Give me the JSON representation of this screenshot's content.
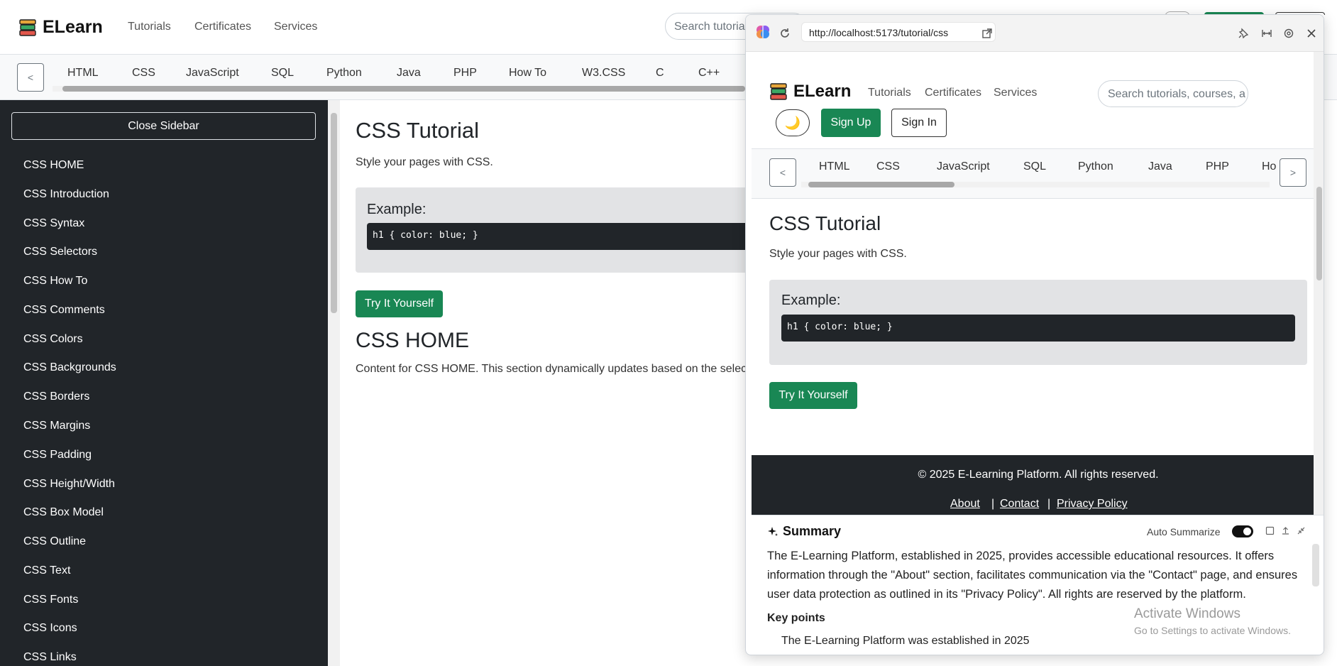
{
  "main": {
    "brand": "ELearn",
    "nav": [
      "Tutorials",
      "Certificates",
      "Services"
    ],
    "search_placeholder": "Search tutorials, courses, a",
    "subnav_prev": "<",
    "subnav": [
      "HTML",
      "CSS",
      "JavaScript",
      "SQL",
      "Python",
      "Java",
      "PHP",
      "How To",
      "W3.CSS",
      "C",
      "C++"
    ],
    "close_sidebar": "Close Sidebar",
    "sidebar": [
      "CSS HOME",
      "CSS Introduction",
      "CSS Syntax",
      "CSS Selectors",
      "CSS How To",
      "CSS Comments",
      "CSS Colors",
      "CSS Backgrounds",
      "CSS Borders",
      "CSS Margins",
      "CSS Padding",
      "CSS Height/Width",
      "CSS Box Model",
      "CSS Outline",
      "CSS Text",
      "CSS Fonts",
      "CSS Icons",
      "CSS Links"
    ],
    "title": "CSS Tutorial",
    "lead": "Style your pages with CSS.",
    "example_title": "Example:",
    "code": "h1 { color: blue; }",
    "try_button": "Try It Yourself",
    "section_title": "CSS HOME",
    "section_text": "Content for CSS HOME. This section dynamically updates based on the selec"
  },
  "overlay": {
    "url": "http://localhost:5173/tutorial/css",
    "brand": "ELearn",
    "nav": [
      "Tutorials",
      "Certificates",
      "Services"
    ],
    "search_placeholder": "Search tutorials, courses, a",
    "theme_icon": "🌙",
    "signup": "Sign Up",
    "signin": "Sign In",
    "subnav_prev": "<",
    "subnav_next": ">",
    "subnav": [
      "HTML",
      "CSS",
      "JavaScript",
      "SQL",
      "Python",
      "Java",
      "PHP",
      "Ho"
    ],
    "title": "CSS Tutorial",
    "lead": "Style your pages with CSS.",
    "example_title": "Example:",
    "code": "h1 { color: blue; }",
    "try_button": "Try It Yourself",
    "footer_copyright": "© 2025 E-Learning Platform. All rights reserved.",
    "footer_links": [
      "About",
      "Contact",
      "Privacy Policy"
    ],
    "footer_sep": "|"
  },
  "summary": {
    "title": "Summary",
    "auto_label": "Auto Summarize",
    "auto_enabled": true,
    "text": "The E-Learning Platform, established in 2025, provides accessible educational resources. It offers information through the \"About\" section, facilitates communication via the \"Contact\" page, and ensures user data protection as outlined in its \"Privacy Policy\". All rights are reserved by the platform.",
    "key_points_label": "Key points",
    "key_point_1": "The E-Learning Platform was established in 2025"
  },
  "windows_notice": {
    "title": "Activate Windows",
    "subtitle": "Go to Settings to activate Windows."
  },
  "colors": {
    "primary_green": "#198754",
    "dark": "#212529"
  }
}
